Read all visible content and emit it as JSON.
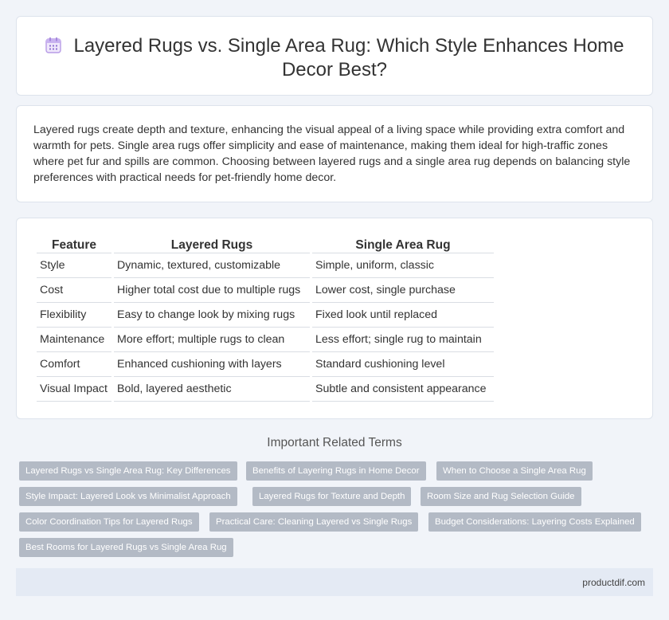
{
  "header": {
    "icon": "calendar-icon",
    "title_line1": "Layered Rugs vs. Single Area Rug: Which Style Enhances Home",
    "title_line2": "Decor Best?"
  },
  "intro": {
    "text": "Layered rugs create depth and texture, enhancing the visual appeal of a living space while providing extra comfort and warmth for pets. Single area rugs offer simplicity and ease of maintenance, making them ideal for high-traffic zones where pet fur and spills are common. Choosing between layered rugs and a single area rug depends on balancing style preferences with practical needs for pet-friendly home decor."
  },
  "comparison": {
    "headers": [
      "Feature",
      "Layered Rugs",
      "Single Area Rug"
    ],
    "rows": [
      [
        "Style",
        "Dynamic, textured, customizable",
        "Simple, uniform, classic"
      ],
      [
        "Cost",
        "Higher total cost due to multiple rugs",
        "Lower cost, single purchase"
      ],
      [
        "Flexibility",
        "Easy to change look by mixing rugs",
        "Fixed look until replaced"
      ],
      [
        "Maintenance",
        "More effort; multiple rugs to clean",
        "Less effort; single rug to maintain"
      ],
      [
        "Comfort",
        "Enhanced cushioning with layers",
        "Standard cushioning level"
      ],
      [
        "Visual Impact",
        "Bold, layered aesthetic",
        "Subtle and consistent appearance"
      ]
    ]
  },
  "related": {
    "title": "Important Related Terms",
    "tags": [
      "Layered Rugs vs Single Area Rug: Key Differences",
      "Benefits of Layering Rugs in Home Decor",
      "When to Choose a Single Area Rug",
      "Style Impact: Layered Look vs Minimalist Approach",
      "Layered Rugs for Texture and Depth",
      "Room Size and Rug Selection Guide",
      "Color Coordination Tips for Layered Rugs",
      "Practical Care: Cleaning Layered vs Single Rugs",
      "Budget Considerations: Layering Costs Explained",
      "Best Rooms for Layered Rugs vs Single Area Rug"
    ]
  },
  "footer": {
    "site": "productdif.com"
  }
}
